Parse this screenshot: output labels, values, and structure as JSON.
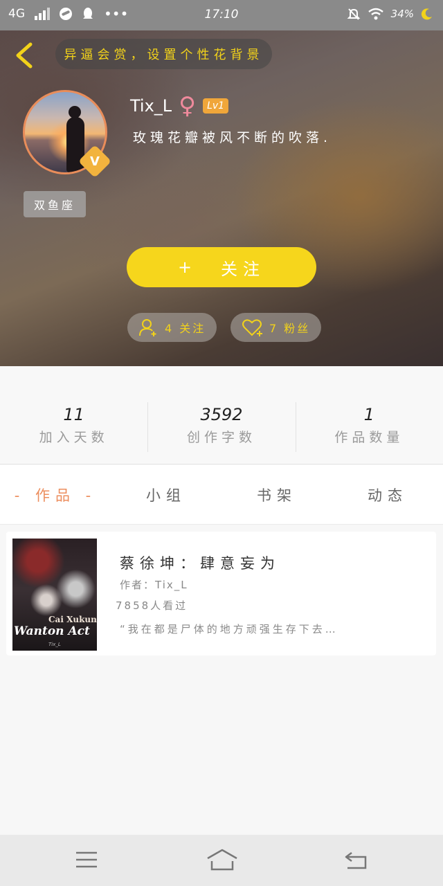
{
  "status_bar": {
    "network": "4G",
    "time": "17:10",
    "battery": "34%"
  },
  "header": {
    "banner_text": "异逼会赏，设置个性花背景",
    "username": "Tix_L",
    "gender_symbol": "♀",
    "level": "Lv1",
    "bio": "玫瑰花瓣被风不断的吹落.",
    "verified_badge": "V",
    "zodiac": "双鱼座",
    "follow_button_icon": "+",
    "follow_button_label": "关注",
    "following_label": "4 关注",
    "followers_label": "7 粉丝"
  },
  "stats": [
    {
      "value": "11",
      "label": "加入天数"
    },
    {
      "value": "3592",
      "label": "创作字数"
    },
    {
      "value": "1",
      "label": "作品数量"
    }
  ],
  "tabs": [
    {
      "label": "- 作品 -",
      "active": true
    },
    {
      "label": "小组",
      "active": false
    },
    {
      "label": "书架",
      "active": false
    },
    {
      "label": "动态",
      "active": false
    }
  ],
  "work": {
    "title": "蔡徐坤：肆意妄为",
    "author": "作者：Tix_L",
    "views": "7858人看过",
    "description": "“我在都是尸体的地方顽强生存下去…",
    "cover": {
      "subtitle": "Cai Xukun",
      "title": "Wanton Act",
      "author": "Tix_L"
    }
  },
  "colors": {
    "accent_yellow": "#f6d61c",
    "accent_orange": "#ec8e5e",
    "banner_text": "#f2d21a"
  },
  "icons": [
    "back-arrow-icon",
    "add-user-icon",
    "heart-icon",
    "menu-icon",
    "home-icon",
    "back-icon"
  ]
}
